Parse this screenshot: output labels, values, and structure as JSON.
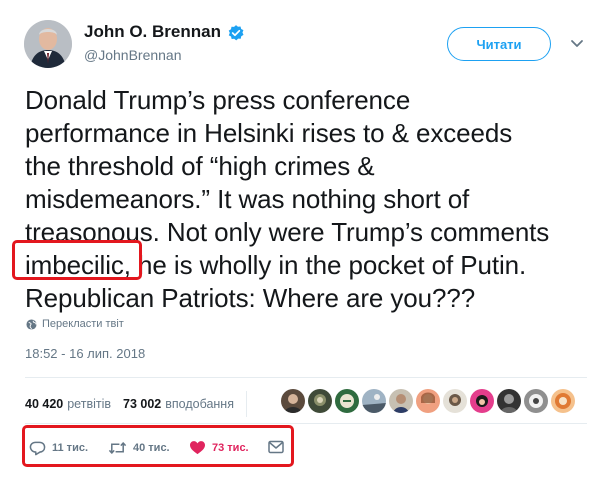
{
  "header": {
    "display_name": "John O. Brennan",
    "handle": "@JohnBrennan",
    "follow_label": "Читати"
  },
  "tweet": {
    "lines": [
      "Donald Trump’s press conference",
      "performance in Helsinki rises to & exceeds",
      "the threshold of “high crimes &",
      "misdemeanors.” It was nothing short of",
      "treasonous. Not only were Trump’s comments",
      "he is wholly in the pocket of Putin.",
      "Republican Patriots: Where are you???"
    ],
    "highlighted_word": "imbecilic,",
    "translate_label": "Перекласти твіт",
    "timestamp": "18:52 - 16 лип. 2018"
  },
  "stats": {
    "retweets_count": "40 420",
    "retweets_label": "ретвітів",
    "likes_count": "73 002",
    "likes_label": "вподобання"
  },
  "actions": {
    "reply_count": "11 тис.",
    "retweet_count": "40 тис.",
    "like_count": "73 тис."
  },
  "colors": {
    "accent": "#1da1f2",
    "like": "#e0245e",
    "highlight": "#e3171e",
    "secondary_text": "#657786"
  }
}
